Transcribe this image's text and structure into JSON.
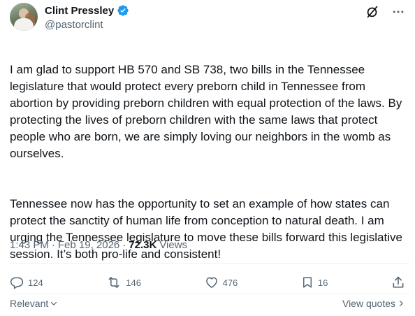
{
  "author": {
    "display_name": "Clint Pressley",
    "handle": "@pastorclint",
    "verified": true
  },
  "top_icons": [
    "grok-icon",
    "more-icon"
  ],
  "post": {
    "paragraph_1": "I am glad to support HB 570 and SB 738, two bills in the Tennessee legislature that would protect every preborn child in Tennessee from abortion by providing preborn children with equal protection of the laws. By protecting the lives of preborn children with the same laws that protect people who are born, we are simply loving our neighbors in the womb as ourselves.",
    "paragraph_2": "Tennessee now has the opportunity to set an example of how states can protect the sanctity of human life from conception to natural death. I am urging the Tennessee legislature to move these bills forward this legislative session. It’s both pro-life and consistent!"
  },
  "meta": {
    "time": "1:43 PM",
    "separator": "·",
    "date": "Feb 19, 2026",
    "separator2": "·",
    "views_count": "72.3K",
    "views_label": "Views"
  },
  "actions": {
    "replies": "124",
    "reposts": "146",
    "likes": "476",
    "bookmarks": "16"
  },
  "footer": {
    "sort_label": "Relevant",
    "view_quotes_label": "View quotes"
  },
  "colors": {
    "verified_blue": "#1d9bf0",
    "secondary_text": "#536471",
    "primary_text": "#0f1419"
  }
}
